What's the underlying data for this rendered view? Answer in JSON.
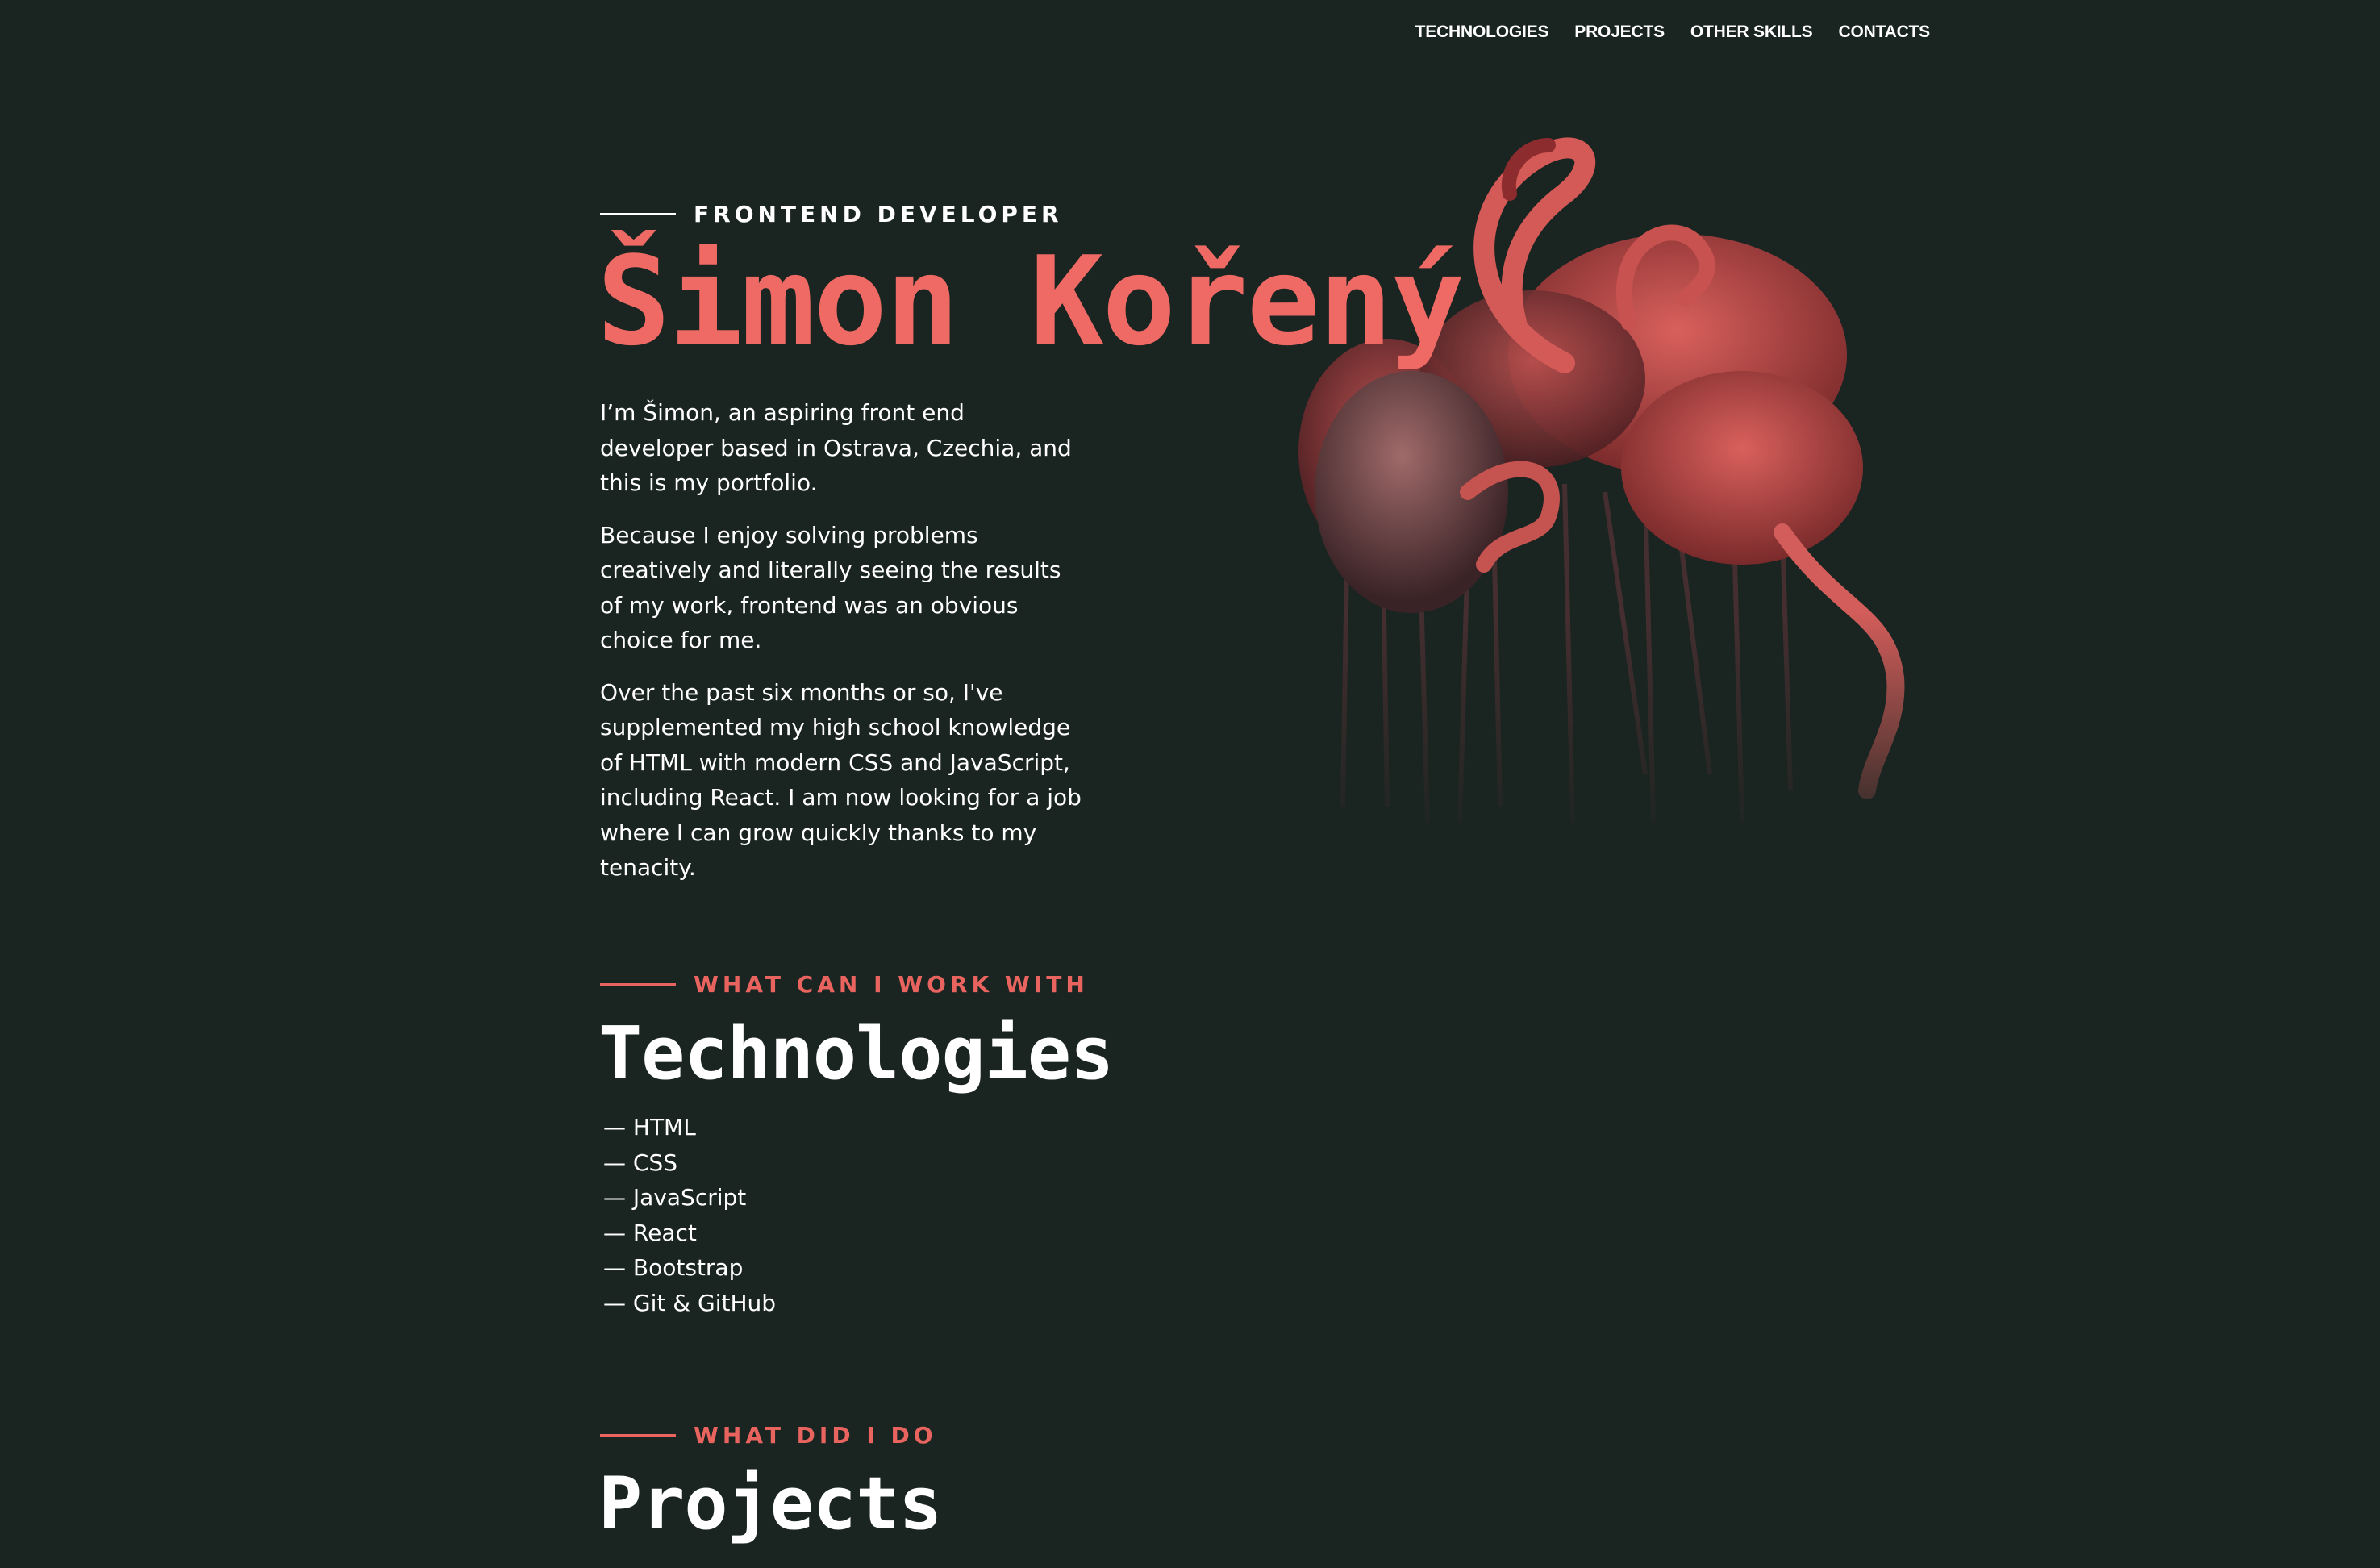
{
  "nav": {
    "items": [
      {
        "label": "TECHNOLOGIES"
      },
      {
        "label": "PROJECTS"
      },
      {
        "label": "OTHER SKILLS"
      },
      {
        "label": "CONTACTS"
      }
    ]
  },
  "hero": {
    "eyebrow": "FRONTEND DEVELOPER",
    "name": "Šimon Kořený",
    "paragraphs": [
      "I’m Šimon, an aspiring front end developer based in Ostrava, Czechia, and this is my portfolio.",
      "Because I enjoy solving problems creatively and literally seeing the results of my work, frontend was an obvious choice for me.",
      "Over the past six months or so, I've supplemented my high school knowledge of HTML with modern CSS and JavaScript, including React. I am now looking for a job where I can grow quickly thanks to my tenacity."
    ],
    "image_icon": "flamingo-image"
  },
  "technologies": {
    "eyebrow": "WHAT CAN I WORK WITH",
    "title": "Technologies",
    "items": [
      "— HTML",
      "— CSS",
      "— JavaScript",
      "— React",
      "— Bootstrap",
      "— Git & GitHub"
    ]
  },
  "projects": {
    "eyebrow": "WHAT DID I DO",
    "title": "Projects"
  },
  "colors": {
    "background": "#1a2421",
    "accent": "#f06a65",
    "text": "#ffffff"
  }
}
